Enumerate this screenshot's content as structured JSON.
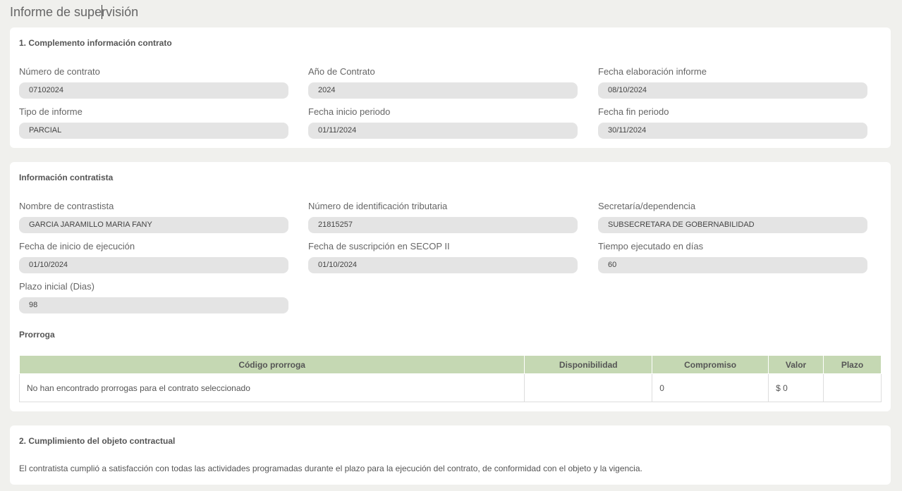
{
  "page": {
    "title_before_caret": "Informe de supe",
    "title_after_caret": "rvisión"
  },
  "section1": {
    "title": "1. Complemento información contrato",
    "fields": [
      {
        "label": "Número de contrato",
        "value": "07102024"
      },
      {
        "label": "Año de Contrato",
        "value": "2024"
      },
      {
        "label": "Fecha elaboración informe",
        "value": "08/10/2024"
      },
      {
        "label": "Tipo de informe",
        "value": "PARCIAL"
      },
      {
        "label": "Fecha inicio periodo",
        "value": "01/11/2024"
      },
      {
        "label": "Fecha fin periodo",
        "value": "30/11/2024"
      }
    ]
  },
  "contractor": {
    "title": "Información contratista",
    "fields": [
      {
        "label": "Nombre de contrastista",
        "value": "GARCIA JARAMILLO MARIA FANY"
      },
      {
        "label": "Número de identificación tributaria",
        "value": "21815257"
      },
      {
        "label": "Secretaría/dependencia",
        "value": "SUBSECRETARA DE GOBERNABILIDAD"
      },
      {
        "label": "Fecha de inicio de ejecución",
        "value": "01/10/2024"
      },
      {
        "label": "Fecha de suscripción en SECOP II",
        "value": "01/10/2024"
      },
      {
        "label": "Tiempo ejecutado en días",
        "value": "60"
      },
      {
        "label": "Plazo inicial (Dias)",
        "value": "98"
      }
    ],
    "prorroga": {
      "title": "Prorroga",
      "columns": [
        "Código prorroga",
        "Disponibilidad",
        "Compromiso",
        "Valor",
        "Plazo"
      ],
      "row": [
        "No han encontrado prorrogas para el contrato seleccionado",
        "",
        "0",
        "$ 0",
        ""
      ]
    }
  },
  "section2": {
    "title": "2. Cumplimiento del objeto contractual",
    "text": "El contratista cumplió a satisfacción con todas las actividades programadas durante el plazo para la ejecución del contrato, de conformidad con el objeto y la vigencia."
  }
}
